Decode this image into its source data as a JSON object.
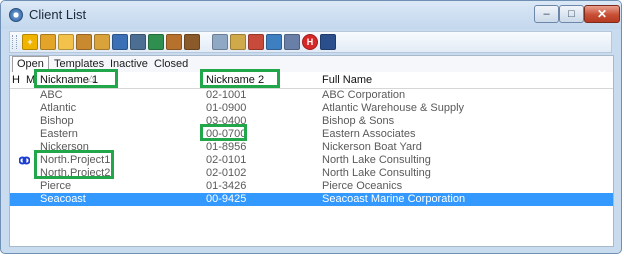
{
  "window": {
    "title": "Client List",
    "min_label": "‒",
    "max_label": "□",
    "close_label": "✕"
  },
  "toolbar": {
    "buttons": [
      {
        "name": "new-client-icon",
        "color": "#f0b400",
        "glyph": "+"
      },
      {
        "name": "open-folder-icon",
        "color": "#e2a529",
        "glyph": ""
      },
      {
        "name": "folder-icon",
        "color": "#f3c24a",
        "glyph": ""
      },
      {
        "name": "users-icon",
        "color": "#c98a2f",
        "glyph": ""
      },
      {
        "name": "key-icon",
        "color": "#d9a23b",
        "glyph": ""
      },
      {
        "name": "person-card-icon",
        "color": "#3b6fb6",
        "glyph": ""
      },
      {
        "name": "bank-icon",
        "color": "#4d6e93",
        "glyph": ""
      },
      {
        "name": "globe-icon",
        "color": "#2f8f4f",
        "glyph": ""
      },
      {
        "name": "group-icon",
        "color": "#b8702d",
        "glyph": ""
      },
      {
        "name": "archive-icon",
        "color": "#8a5a2b",
        "glyph": ""
      },
      {
        "name": "edit-icon",
        "color": "#8fa8c4",
        "glyph": ""
      },
      {
        "name": "copy-icon",
        "color": "#d0a94a",
        "glyph": ""
      },
      {
        "name": "report-icon",
        "color": "#c84a3a",
        "glyph": ""
      },
      {
        "name": "import-icon",
        "color": "#3d7fc1",
        "glyph": ""
      },
      {
        "name": "database-icon",
        "color": "#6a7fa8",
        "glyph": ""
      },
      {
        "name": "help-icon",
        "color": "#d62828",
        "glyph": "H"
      },
      {
        "name": "window-icon",
        "color": "#2a4f8c",
        "glyph": ""
      }
    ]
  },
  "tabs": [
    "Open",
    "Templates",
    "Inactive",
    "Closed"
  ],
  "columns": {
    "h": "H",
    "m": "M",
    "nickname1": "Nickname 1",
    "nickname2": "Nickname 2",
    "fullname": "Full Name"
  },
  "rows": [
    {
      "nick1": "ABC",
      "nick2": "02-1001",
      "full": "ABC Corporation",
      "icon": false,
      "selected": false
    },
    {
      "nick1": "Atlantic",
      "nick2": "01-0900",
      "full": "Atlantic Warehouse & Supply",
      "icon": false,
      "selected": false
    },
    {
      "nick1": "Bishop",
      "nick2": "03-0400",
      "full": "Bishop & Sons",
      "icon": false,
      "selected": false
    },
    {
      "nick1": "Eastern",
      "nick2": "00-0700",
      "full": "Eastern Associates",
      "icon": false,
      "selected": false
    },
    {
      "nick1": "Nickerson",
      "nick2": "01-8956",
      "full": "Nickerson Boat Yard",
      "icon": false,
      "selected": false
    },
    {
      "nick1": "North.Project1",
      "nick2": "02-0101",
      "full": "North Lake Consulting",
      "icon": true,
      "selected": false
    },
    {
      "nick1": "North.Project2",
      "nick2": "02-0102",
      "full": "North Lake Consulting",
      "icon": false,
      "selected": false
    },
    {
      "nick1": "Pierce",
      "nick2": "01-3426",
      "full": "Pierce Oceanics",
      "icon": false,
      "selected": false
    },
    {
      "nick1": "Seacoast",
      "nick2": "00-9425",
      "full": "Seacoast Marine Corporation",
      "icon": false,
      "selected": true
    }
  ],
  "colors": {
    "selection": "#3399ff",
    "highlight_box": "#21a64a",
    "link_icon": "#1c3fd1"
  }
}
